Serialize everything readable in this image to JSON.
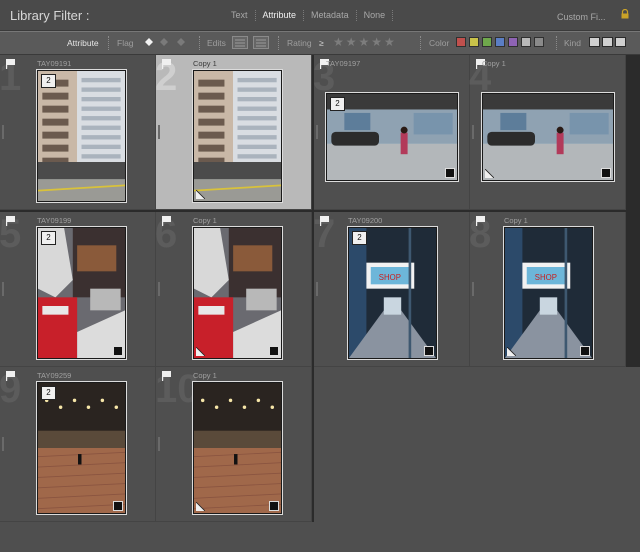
{
  "header": {
    "title": "Library Filter :",
    "tabs": [
      {
        "label": "Text",
        "active": false
      },
      {
        "label": "Attribute",
        "active": true
      },
      {
        "label": "Metadata",
        "active": false
      },
      {
        "label": "None",
        "active": false
      }
    ],
    "preset": "Custom Fi..."
  },
  "attribute_bar": {
    "section_label": "Attribute",
    "flag_label": "Flag",
    "edits_label": "Edits",
    "rating_label": "Rating",
    "rating_operator": "≥",
    "rating_stars": "★★★★★",
    "color_label": "Color",
    "color_swatches": [
      "#c0504d",
      "#c9c34a",
      "#6fa84c",
      "#5b7ec4",
      "#8e63b4",
      "#b9b9b9",
      "#8a8a8a"
    ],
    "kind_label": "Kind"
  },
  "grid": {
    "cells": [
      {
        "index": "1",
        "caption": "TAY09191",
        "selected": false,
        "stack_count": "2",
        "scene": "building"
      },
      {
        "index": "2",
        "caption": "Copy 1",
        "selected": true,
        "stack_count": "",
        "scene": "building"
      },
      {
        "index": "3",
        "caption": "TAY09197",
        "selected": false,
        "stack_count": "2",
        "scene": "street"
      },
      {
        "index": "4",
        "caption": "Copy 1",
        "selected": false,
        "stack_count": "",
        "scene": "street"
      },
      {
        "index": "5",
        "caption": "TAY09199",
        "selected": false,
        "stack_count": "2",
        "scene": "market"
      },
      {
        "index": "6",
        "caption": "Copy 1",
        "selected": false,
        "stack_count": "",
        "scene": "market"
      },
      {
        "index": "7",
        "caption": "TAY09200",
        "selected": false,
        "stack_count": "2",
        "scene": "station"
      },
      {
        "index": "8",
        "caption": "Copy 1",
        "selected": false,
        "stack_count": "",
        "scene": "station"
      },
      {
        "index": "9",
        "caption": "TAY09259",
        "selected": false,
        "stack_count": "2",
        "scene": "plaza"
      },
      {
        "index": "10",
        "caption": "Copy 1",
        "selected": false,
        "stack_count": "",
        "scene": "plaza"
      }
    ]
  }
}
